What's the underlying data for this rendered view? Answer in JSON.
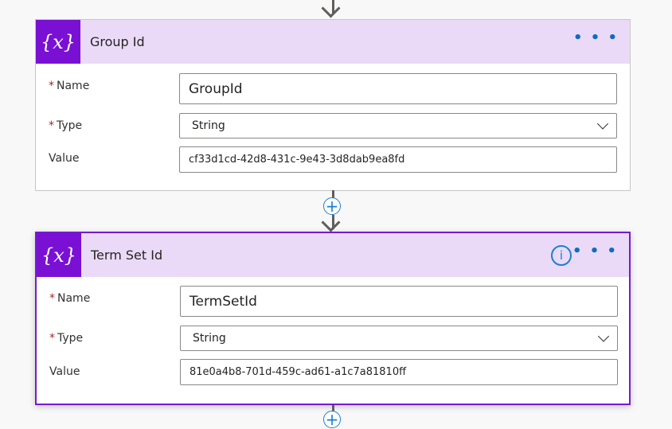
{
  "cards": [
    {
      "icon": "{x}",
      "title": "Group Id",
      "more": "• • •",
      "fields": {
        "name_label": "Name",
        "type_label": "Type",
        "value_label": "Value",
        "name": "GroupId",
        "type": "String",
        "value": "cf33d1cd-42d8-431c-9e43-3d8dab9ea8fd"
      }
    },
    {
      "icon": "{x}",
      "title": "Term Set Id",
      "info": "i",
      "more": "• • •",
      "fields": {
        "name_label": "Name",
        "type_label": "Type",
        "value_label": "Value",
        "name": "TermSetId",
        "type": "String",
        "value": "81e0a4b8-701d-459c-ad61-a1c7a81810ff"
      }
    }
  ],
  "required_mark": "*",
  "add_step": "+"
}
